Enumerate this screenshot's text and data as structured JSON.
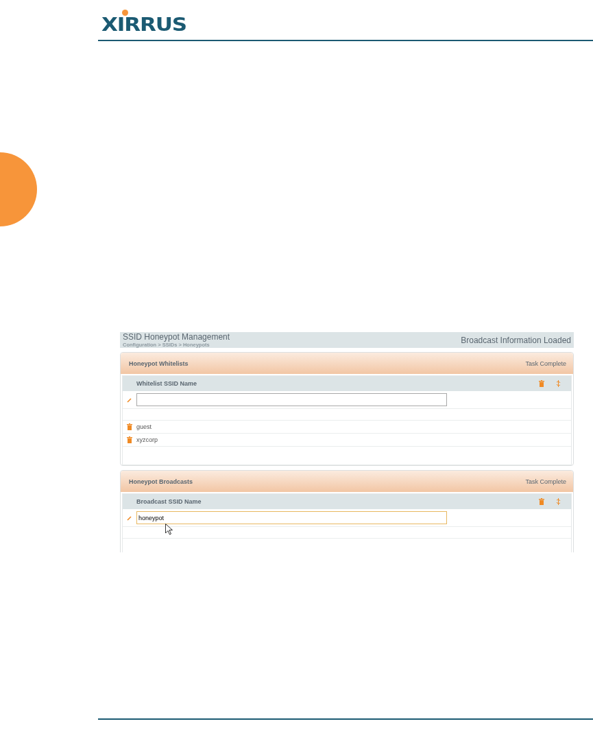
{
  "logo": {
    "text": "XIRRUS"
  },
  "panel": {
    "title": "SSID Honeypot Management",
    "breadcrumb": "Configuration > SSIDs > Honeypots",
    "status": "Broadcast Information Loaded",
    "sections": [
      {
        "title": "Honeypot Whitelists",
        "status": "Task Complete",
        "column": "Whitelist SSID Name",
        "input": {
          "focused": false
        },
        "rows": [
          "guest",
          "xyzcorp"
        ],
        "pointer": false
      },
      {
        "title": "Honeypot Broadcasts",
        "status": "Task Complete",
        "column": "Broadcast SSID Name",
        "input": {
          "value": "honeypot",
          "focused": true
        },
        "pointer": true
      }
    ]
  }
}
